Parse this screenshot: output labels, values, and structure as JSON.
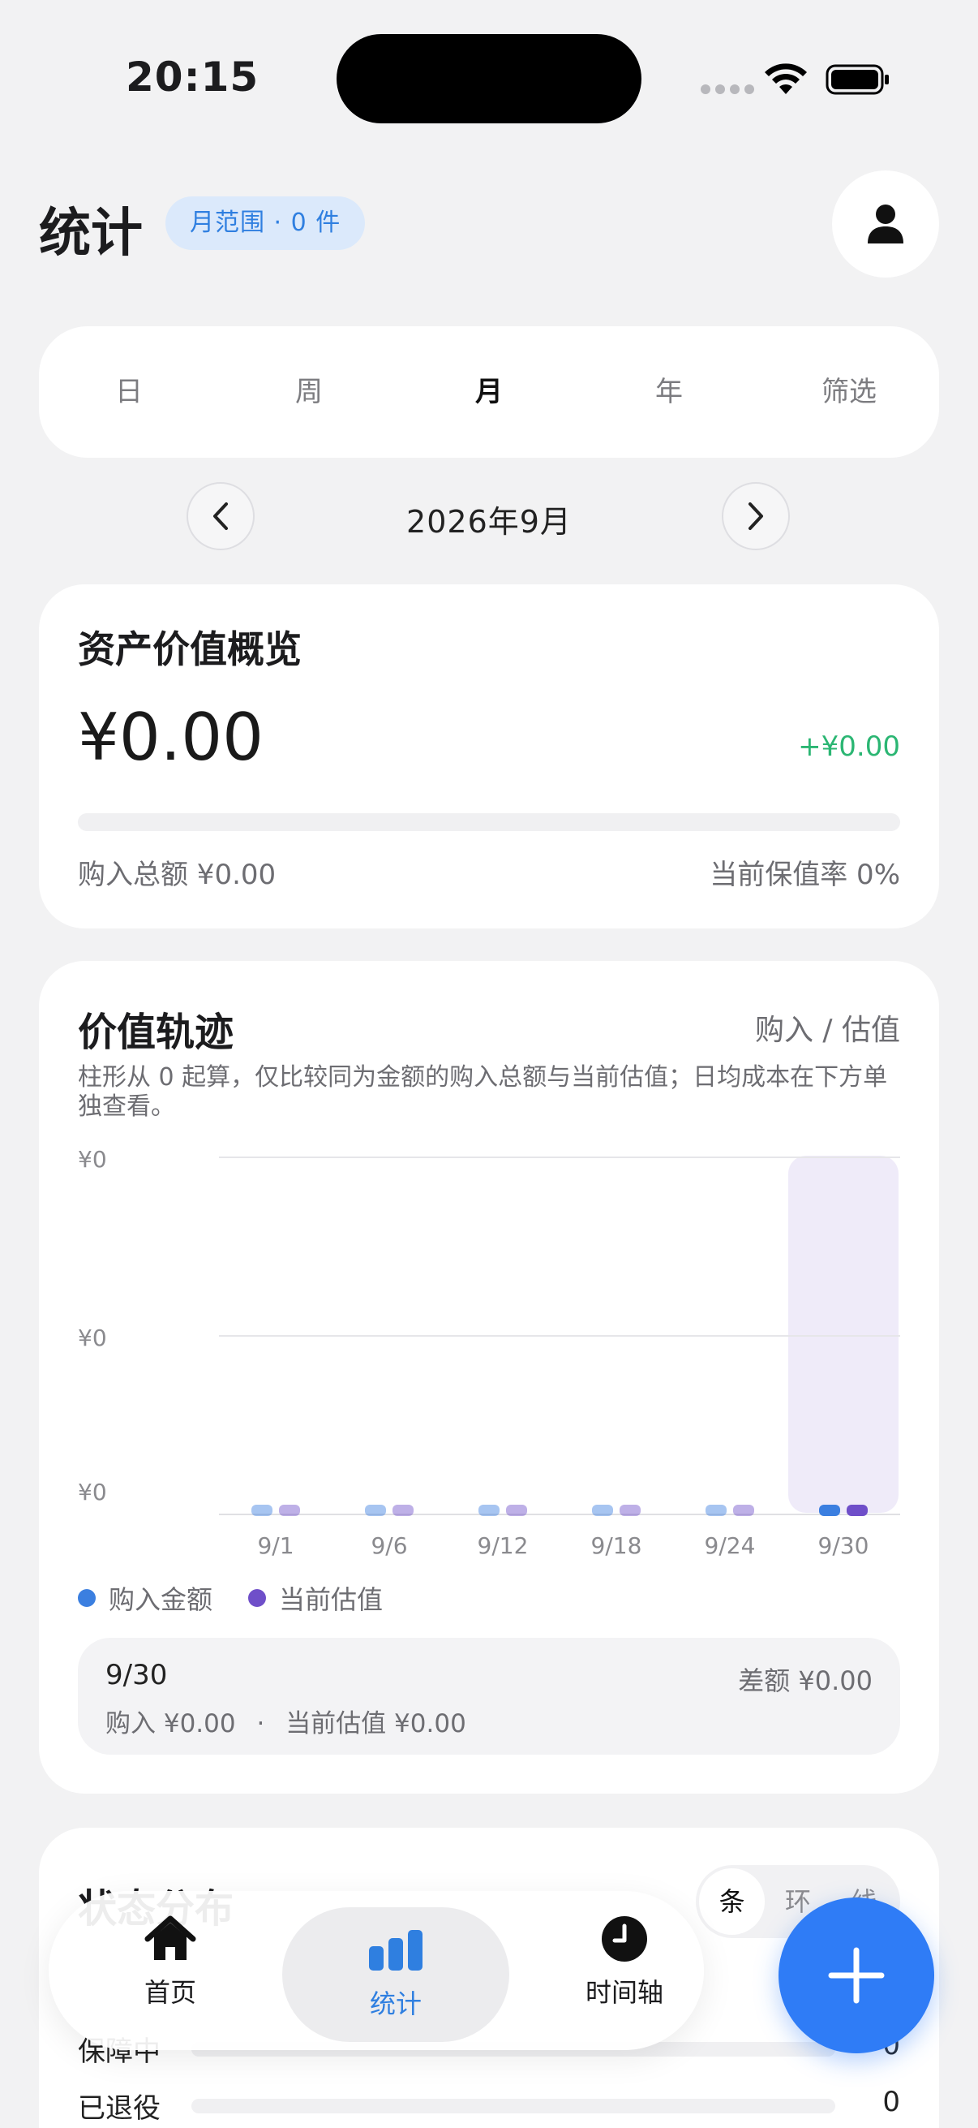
{
  "status_bar": {
    "time": "20:15"
  },
  "header": {
    "title": "统计",
    "range_badge": "月范围 · 0 件"
  },
  "tabs": [
    "日",
    "周",
    "月",
    "年",
    "筛选"
  ],
  "active_tab": "月",
  "period": {
    "label": "2026年9月"
  },
  "overview": {
    "title": "资产价值概览",
    "amount": "¥0.00",
    "change": "+¥0.00",
    "progress_fraction": 0,
    "purchase_total": "购入总额 ¥0.00",
    "retention_rate": "当前保值率 0%"
  },
  "trend": {
    "title": "价值轨迹",
    "mode": "购入 / 估值",
    "description": "柱形从 0 起算，仅比较同为金额的购入总额与当前估值；日均成本在下方单独查看。",
    "legend": {
      "purchase": "购入金额",
      "valuation": "当前估值"
    },
    "detail": {
      "date": "9/30",
      "diff": "差额 ¥0.00",
      "purchase": "购入 ¥0.00",
      "separator": "·",
      "valuation": "当前估值 ¥0.00"
    }
  },
  "chart_data": {
    "type": "bar",
    "categories": [
      "9/1",
      "9/6",
      "9/12",
      "9/18",
      "9/24",
      "9/30"
    ],
    "series": [
      {
        "name": "购入金额",
        "values": [
          0,
          0,
          0,
          0,
          0,
          0
        ]
      },
      {
        "name": "当前估值",
        "values": [
          0,
          0,
          0,
          0,
          0,
          0
        ]
      }
    ],
    "y_tick_labels": [
      "¥0",
      "¥0",
      "¥0"
    ],
    "ylim": [
      0,
      0
    ],
    "highlighted_category": "9/30",
    "grid": true
  },
  "status_card": {
    "title": "状态分布",
    "segments": [
      "条",
      "环",
      "线"
    ],
    "active_segment": "条",
    "rows": [
      {
        "label": "保障中",
        "value": "0"
      },
      {
        "label": "已退役",
        "value": "0"
      }
    ]
  },
  "tabbar": {
    "items": [
      {
        "label": "首页",
        "icon": "home-icon"
      },
      {
        "label": "统计",
        "icon": "bar-chart-icon"
      },
      {
        "label": "时间轴",
        "icon": "clock-icon"
      }
    ],
    "active": "统计"
  },
  "fab": {
    "icon": "plus-icon"
  },
  "colors": {
    "accent": "#2f7cf6",
    "purchase": "#3b7fe0",
    "valuation": "#6f4fc9",
    "positive": "#2bb673",
    "highlight": "#efebf9"
  }
}
